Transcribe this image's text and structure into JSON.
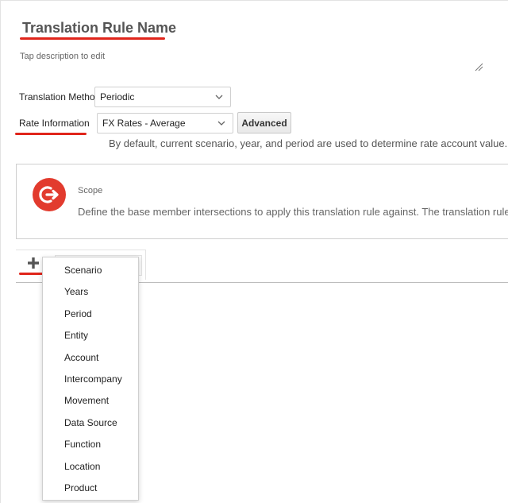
{
  "rule": {
    "name": "Translation Rule Name",
    "description_placeholder": "Tap description to edit"
  },
  "translation_method": {
    "label": "Translation Method",
    "value": "Periodic"
  },
  "rate_information": {
    "label": "Rate Information",
    "value": "FX Rates - Average",
    "advanced_label": "Advanced",
    "note": "By default, current scenario, year, and period are used to determine rate account value. C"
  },
  "scope": {
    "title": "Scope",
    "description": "Define the base member intersections to apply this translation rule against. The translation rule w"
  },
  "dimension_menu": {
    "items": [
      {
        "label": "Scenario"
      },
      {
        "label": "Years"
      },
      {
        "label": "Period"
      },
      {
        "label": "Entity"
      },
      {
        "label": "Account"
      },
      {
        "label": "Intercompany"
      },
      {
        "label": "Movement"
      },
      {
        "label": "Data Source"
      },
      {
        "label": "Function"
      },
      {
        "label": "Location"
      },
      {
        "label": "Product"
      }
    ]
  },
  "colors": {
    "accent_red": "#e0251b",
    "icon_red": "#e23b2e"
  },
  "icons": {
    "add": "plus-icon",
    "scope": "scope-icon",
    "select": "chevron-down-icon"
  }
}
